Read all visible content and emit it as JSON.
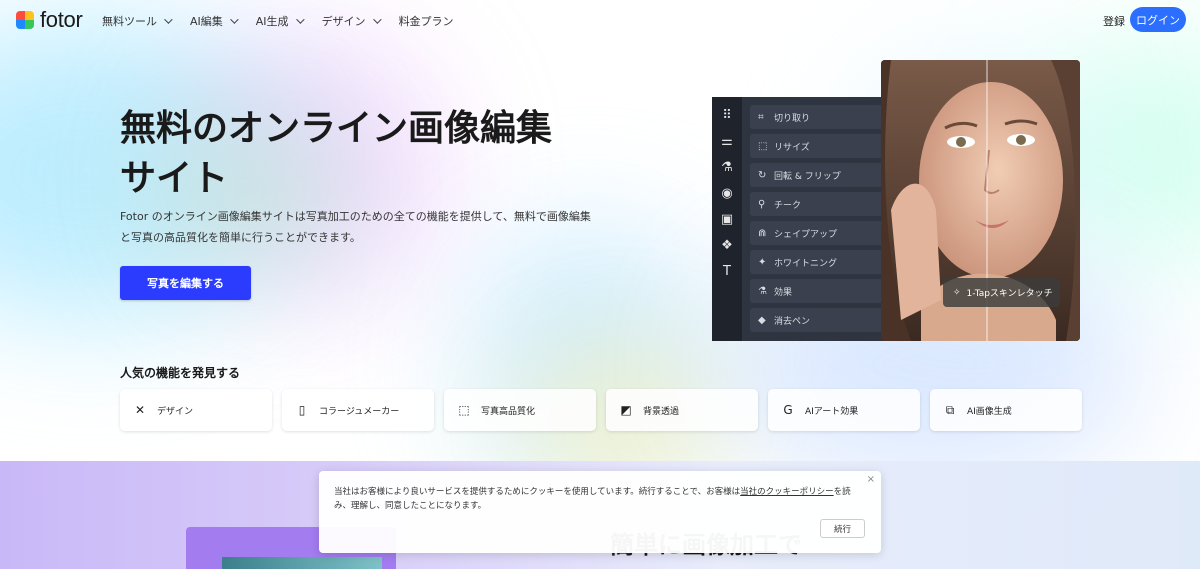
{
  "brand": {
    "name": "fotor",
    "logo_colors": [
      "#ff4b3e",
      "#ffc21c",
      "#1e88ff",
      "#34c759"
    ]
  },
  "nav": {
    "items": [
      {
        "label": "無料ツール",
        "has_dropdown": true
      },
      {
        "label": "AI編集",
        "has_dropdown": true
      },
      {
        "label": "AI生成",
        "has_dropdown": true
      },
      {
        "label": "デザイン",
        "has_dropdown": true
      },
      {
        "label": "料金プラン",
        "has_dropdown": false
      }
    ],
    "register_label": "登録",
    "login_label": "ログイン"
  },
  "hero": {
    "title_line1": "無料のオンライン画像編集",
    "title_line2": "サイト",
    "description": "Fotor のオンライン画像編集サイトは写真加工のための全ての機能を提供して、無料で画像編集と写真の高品質化を簡単に行うことができます。",
    "cta_label": "写真を編集する"
  },
  "editor_mock": {
    "rail_icons": [
      "grid-icon",
      "sliders-icon",
      "flask-icon",
      "eye-icon",
      "frame-icon",
      "shapes-icon",
      "text-icon"
    ],
    "tools": [
      {
        "label": "切り取り",
        "icon": "crop-icon"
      },
      {
        "label": "リサイズ",
        "icon": "resize-icon"
      },
      {
        "label": "回転 & フリップ",
        "icon": "rotate-icon"
      },
      {
        "label": "チーク",
        "icon": "blush-icon"
      },
      {
        "label": "シェイプアップ",
        "icon": "shape-up-icon"
      },
      {
        "label": "ホワイトニング",
        "icon": "whitening-icon"
      },
      {
        "label": "効果",
        "icon": "effect-icon"
      },
      {
        "label": "消去ペン",
        "icon": "eraser-icon"
      }
    ],
    "badge_label": "1-Tapスキンレタッチ"
  },
  "features": {
    "title": "人気の機能を発見する",
    "items": [
      {
        "label": "デザイン",
        "icon": "design-icon"
      },
      {
        "label": "コラージュメーカー",
        "icon": "collage-icon"
      },
      {
        "label": "写真高品質化",
        "icon": "enhance-icon"
      },
      {
        "label": "背景透過",
        "icon": "background-remove-icon"
      },
      {
        "label": "AIアート効果",
        "icon": "ai-art-icon"
      },
      {
        "label": "AI画像生成",
        "icon": "ai-image-icon"
      }
    ]
  },
  "lower": {
    "heading_visible": "簡単に画像加工で"
  },
  "cookie": {
    "text_before": "当社はお客様により良いサービスを提供するためにクッキーを使用しています。続行することで、お客様は",
    "link": "当社のクッキーポリシー",
    "text_after": "を読み、理解し、同意したことになります。",
    "continue_label": "続行",
    "close_label": "×"
  }
}
